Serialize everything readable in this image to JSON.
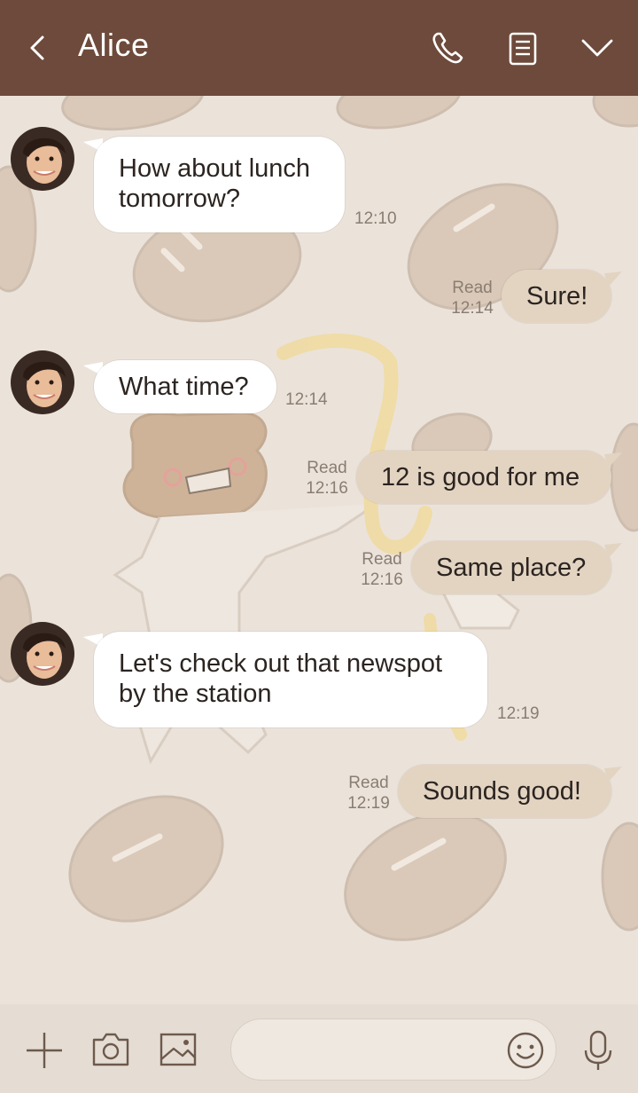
{
  "header": {
    "title": "Alice",
    "icons": [
      "back-arrow-icon",
      "phone-icon",
      "notes-icon",
      "chevron-down-icon"
    ]
  },
  "messages": [
    {
      "sender": "contact",
      "text": "How about lunch tomorrow?",
      "lines": [
        "How about lunch",
        "tomorrow?"
      ],
      "time": "12:10"
    },
    {
      "sender": "me",
      "text": "Sure!",
      "read": "Read",
      "time": "12:14"
    },
    {
      "sender": "contact",
      "text": "What time?",
      "lines": [
        "What time?"
      ],
      "time": "12:14"
    },
    {
      "sender": "me",
      "text": "12 is good for me",
      "read": "Read",
      "time": "12:16"
    },
    {
      "sender": "me",
      "text": "Same place?",
      "read": "Read",
      "time": "12:16"
    },
    {
      "sender": "contact",
      "text": "Let's check out that newspot by the station",
      "lines": [
        "Let's check out that newspot",
        "by the station"
      ],
      "time": "12:19"
    },
    {
      "sender": "me",
      "text": "Sounds good!",
      "read": "Read",
      "time": "12:19"
    }
  ],
  "footer": {
    "input_value": "",
    "input_placeholder": "",
    "icons": [
      "plus-icon",
      "camera-icon",
      "image-icon",
      "emoji-icon",
      "microphone-icon"
    ]
  },
  "colors": {
    "header_bg": "#6d4a3b",
    "chat_bg": "#ebe3da",
    "incoming_bubble": "#ffffff",
    "outgoing_bubble": "#e3d4c2",
    "footer_bg": "#e5ddd3"
  }
}
